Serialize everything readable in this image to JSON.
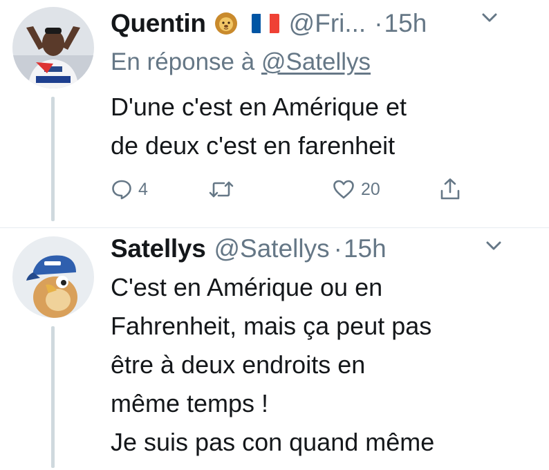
{
  "tweets": [
    {
      "display_name": "Quentin",
      "name_emojis": [
        "lion-face-icon",
        "flag-france-icon"
      ],
      "handle": "@Fri...",
      "separator": "·",
      "time": "15h",
      "reply_prefix": "En réponse à",
      "reply_mention": "@Satellys",
      "text_lines": [
        "D'une c'est en Amérique et",
        "de deux c'est en farenheit"
      ],
      "actions": {
        "reply_count": "4",
        "retweet_count": "",
        "like_count": "20"
      }
    },
    {
      "display_name": "Satellys",
      "handle": "@Satellys",
      "separator": "·",
      "time": "15h",
      "text_lines": [
        "C'est en Amérique ou en",
        "Fahrenheit, mais ça peut pas",
        "être à deux endroits en",
        "même temps !",
        "Je suis pas con quand même"
      ]
    }
  ],
  "colors": {
    "text": "#14171a",
    "secondary": "#657786",
    "thread_line": "#cfd9de",
    "flag_blue": "#0055a4",
    "flag_white": "#ffffff",
    "flag_red": "#ef4135"
  },
  "icons": {
    "reply": "speech-bubble-icon",
    "retweet": "retweet-icon",
    "like": "heart-icon",
    "share": "share-icon",
    "more": "chevron-down-icon"
  }
}
